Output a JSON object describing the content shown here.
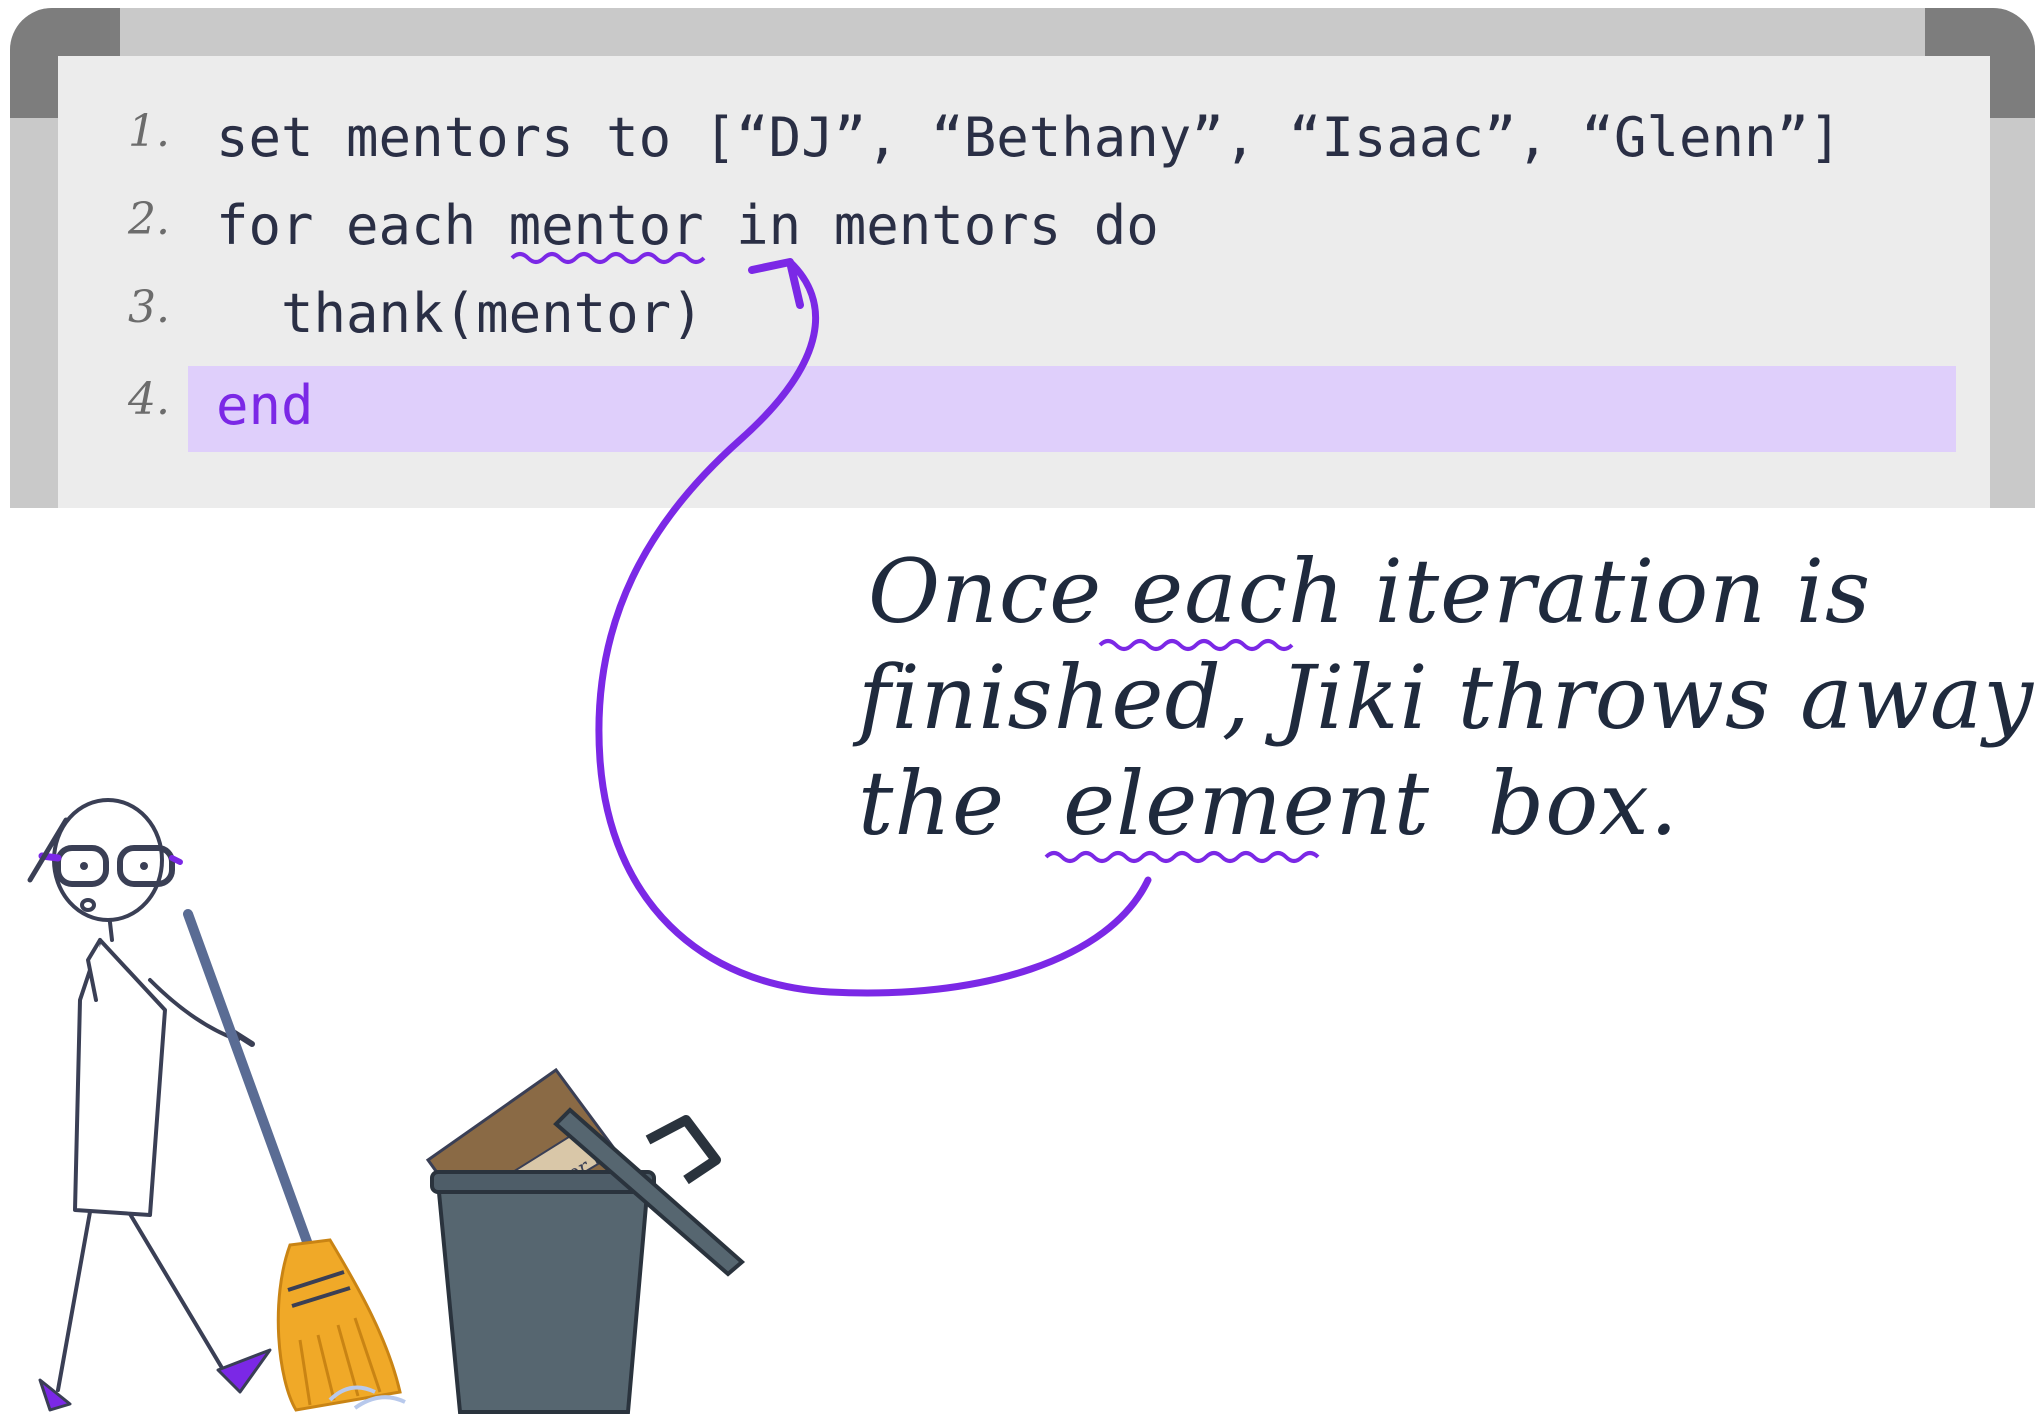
{
  "code": {
    "lines": [
      {
        "num": "1.",
        "text": "set mentors to [“DJ”, “Bethany”, “Isaac”, “Glenn”]"
      },
      {
        "num": "2.",
        "text": "for each mentor in mentors do"
      },
      {
        "num": "3.",
        "text": "  thank(mentor)"
      },
      {
        "num": "4.",
        "text": "end"
      }
    ],
    "highlighted_line": 4
  },
  "note": {
    "line1": "Once each iteration is",
    "line2": "finished, Jiki throws away",
    "line3": "the  element  box.",
    "underlined_words": [
      "each",
      "element"
    ]
  },
  "illustration": {
    "box_label": "mentor",
    "icons": [
      "jiki-character-sweeping-icon",
      "broom-icon",
      "trash-bin-icon",
      "cardboard-box-icon",
      "curved-arrow-icon"
    ]
  },
  "colors": {
    "accent": "#7b28e6",
    "highlight": "#dfcffb",
    "ink": "#1f2a3d",
    "board_frame": "#c9c9c9",
    "board_surface": "#ececec",
    "bin": "#566670",
    "box": "#8a6a45",
    "broom": "#f0a928"
  }
}
